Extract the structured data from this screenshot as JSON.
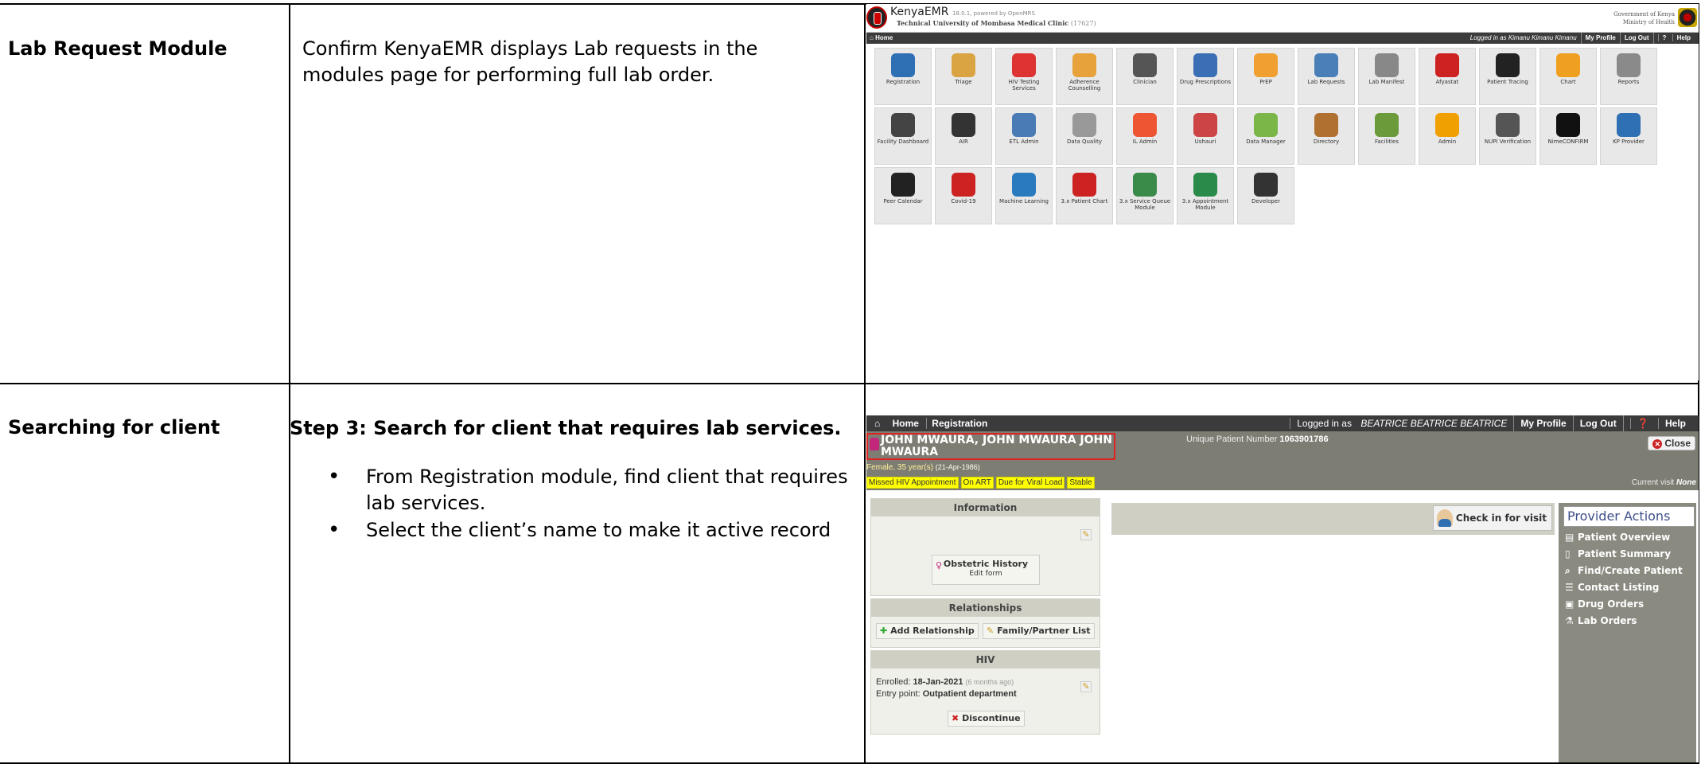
{
  "rows": [
    {
      "title": "Lab Request Module",
      "description": "Confirm KenyaEMR displays Lab requests in the modules page for performing full lab order."
    },
    {
      "title": "Searching for client",
      "step_title": "Step 3: Search for client that requires lab services.",
      "bullets": [
        "From Registration module, find client that requires lab services.",
        "Select the client’s name to make it active record"
      ]
    }
  ],
  "home_screen": {
    "brand": "KenyaEMR",
    "version": "18.0.1, powered by OpenMRS",
    "facility": "Technical University of Mombasa Medical Clinic",
    "facility_code": "(17627)",
    "gov_line1": "Government of Kenya",
    "gov_line2": "Ministry of Health",
    "nav_home": "Home",
    "logged_in": "Logged in as Kimanu Kimanu Kimanu",
    "my_profile": "My Profile",
    "log_out": "Log Out",
    "help": "Help",
    "apps": [
      {
        "label": "Registration",
        "color": "#2f6fb3",
        "icon": "person-icon"
      },
      {
        "label": "Triage",
        "color": "#d9a441",
        "icon": "clipboard-icon"
      },
      {
        "label": "HIV Testing Services",
        "color": "#d33",
        "icon": "ribbon-icon"
      },
      {
        "label": "Adherence Counselling",
        "color": "#e7a23c",
        "icon": "puzzle-icon"
      },
      {
        "label": "Clinician",
        "color": "#555",
        "icon": "doctor-icon"
      },
      {
        "label": "Drug Prescriptions",
        "color": "#3b6fb5",
        "icon": "rx-icon"
      },
      {
        "label": "PrEP",
        "color": "#f0a030",
        "icon": "pill-bottle-icon"
      },
      {
        "label": "Lab Requests",
        "color": "#4b7fb8",
        "icon": "microscope-icon"
      },
      {
        "label": "Lab Manifest",
        "color": "#888",
        "icon": "lab-manifest-icon"
      },
      {
        "label": "Afyastat",
        "color": "#c22",
        "icon": "afyastat-icon"
      },
      {
        "label": "Patient Tracing",
        "color": "#222",
        "icon": "search-person-icon"
      },
      {
        "label": "Chart",
        "color": "#f0a020",
        "icon": "folder-icon"
      },
      {
        "label": "Reports",
        "color": "#8a8a8a",
        "icon": "report-icon"
      },
      {
        "label": "Facility Dashboard",
        "color": "#444",
        "icon": "dashboard-icon"
      },
      {
        "label": "AIR",
        "color": "#333",
        "icon": "group-icon"
      },
      {
        "label": "ETL Admin",
        "color": "#4a7bb5",
        "icon": "etl-icon"
      },
      {
        "label": "Data Quality",
        "color": "#999",
        "icon": "database-icon"
      },
      {
        "label": "IL Admin",
        "color": "#e53",
        "icon": "il-icon"
      },
      {
        "label": "Ushauri",
        "color": "#c44",
        "icon": "ushauri-icon"
      },
      {
        "label": "Data Manager",
        "color": "#7ab648",
        "icon": "data-manager-icon"
      },
      {
        "label": "Directory",
        "color": "#b07030",
        "icon": "address-book-icon"
      },
      {
        "label": "Facilities",
        "color": "#6a9a3a",
        "icon": "map-icon"
      },
      {
        "label": "Admin",
        "color": "#f0a000",
        "icon": "gear-icon"
      },
      {
        "label": "NUPI Verification",
        "color": "#555",
        "icon": "id-card-icon"
      },
      {
        "label": "NimeCONFIRM",
        "color": "#111",
        "icon": "nimeconfirm-icon"
      },
      {
        "label": "KP Provider",
        "color": "#2f6fb3",
        "icon": "provider-icon"
      },
      {
        "label": "Peer Calendar",
        "color": "#222",
        "icon": "calendar-icon"
      },
      {
        "label": "Covid-19",
        "color": "#c22",
        "icon": "virus-icon"
      },
      {
        "label": "Machine Learning",
        "color": "#2a7abf",
        "icon": "brain-icon"
      },
      {
        "label": "3.x Patient Chart",
        "color": "#c22",
        "icon": "patient-chart-icon"
      },
      {
        "label": "3.x Service Queue Module",
        "color": "#3a8a4a",
        "icon": "queue-icon"
      },
      {
        "label": "3.x Appointment Module",
        "color": "#2a8a4a",
        "icon": "appointment-icon"
      },
      {
        "label": "Developer",
        "color": "#333",
        "icon": "laptop-icon"
      }
    ]
  },
  "registration_screen": {
    "nav_home": "Home",
    "nav_registration": "Registration",
    "logged_in_prefix": "Logged in as",
    "logged_in_user": "BEATRICE BEATRICE BEATRICE",
    "my_profile": "My Profile",
    "log_out": "Log Out",
    "help": "Help",
    "patient_name": "JOHN MWAURA, JOHN MWAURA JOHN MWAURA",
    "upn_label": "Unique Patient Number",
    "upn_value": "1063901786",
    "close": "Close",
    "sex_age": "Female, 35 year(s)",
    "dob": "(21-Apr-1986)",
    "flags": [
      "Missed HIV Appointment",
      "On ART",
      "Due for Viral Load",
      "Stable"
    ],
    "current_visit_label": "Current visit",
    "current_visit_value": "None",
    "information_title": "Information",
    "obstetric_title": "Obstetric History",
    "obstetric_sub": "Edit form",
    "relationships_title": "Relationships",
    "add_relationship": "Add Relationship",
    "family_list": "Family/Partner List",
    "hiv_title": "HIV",
    "enrolled_label": "Enrolled:",
    "enrolled_date": "18-Jan-2021",
    "enrolled_ago": "(6 months ago)",
    "entry_label": "Entry point:",
    "entry_value": "Outpatient department",
    "discontinue": "Discontinue",
    "check_in": "Check in for visit",
    "provider_title": "Provider Actions",
    "provider_actions": [
      {
        "label": "Patient Overview",
        "icon": "overview-icon",
        "glyph": "▤"
      },
      {
        "label": "Patient Summary",
        "icon": "summary-icon",
        "glyph": "▯"
      },
      {
        "label": "Find/Create Patient",
        "icon": "search-icon",
        "glyph": "⌕"
      },
      {
        "label": "Contact Listing",
        "icon": "list-icon",
        "glyph": "☰"
      },
      {
        "label": "Drug Orders",
        "icon": "briefcase-icon",
        "glyph": "▣"
      },
      {
        "label": "Lab Orders",
        "icon": "flask-icon",
        "glyph": "⚗"
      }
    ]
  }
}
